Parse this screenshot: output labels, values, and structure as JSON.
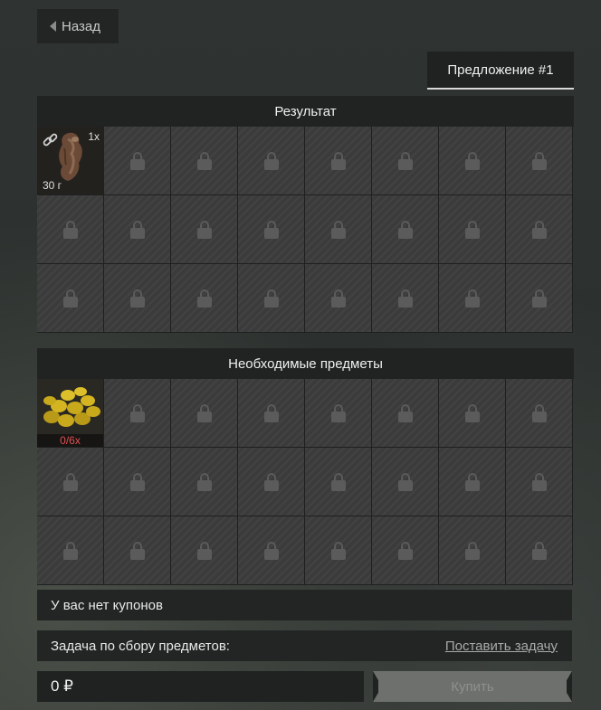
{
  "nav": {
    "back_label": "Назад"
  },
  "offer_tab": {
    "label": "Предложение #1"
  },
  "result_section": {
    "title": "Результат",
    "item": {
      "name": "meat",
      "quantity": "1x",
      "weight": "30 г",
      "icon": "meat-icon",
      "link_icon": "chain-icon"
    }
  },
  "required_section": {
    "title": "Необходимые предметы",
    "item": {
      "name": "coins",
      "count": "0/6x",
      "icon": "coins-icon"
    }
  },
  "coupons": {
    "text": "У вас нет купонов"
  },
  "task": {
    "label": "Задача по сбору предметов:",
    "link": "Поставить задачу"
  },
  "purchase": {
    "price": "0 ₽",
    "buy_label": "Купить"
  },
  "colors": {
    "accent_red": "#e05050",
    "panel": "#222524",
    "cell": "#3a3b3a"
  }
}
